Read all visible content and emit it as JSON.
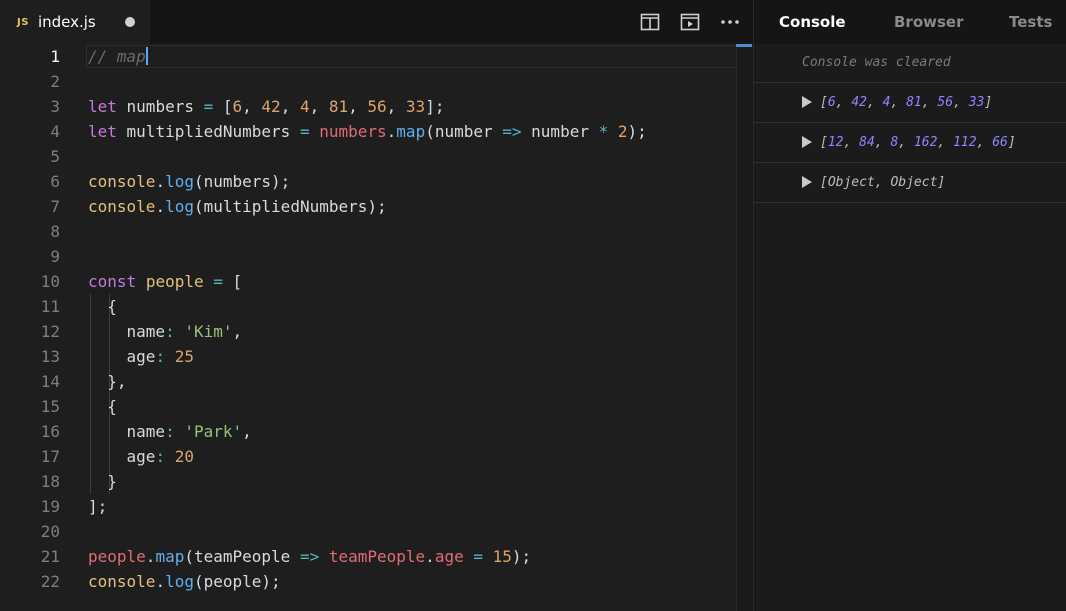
{
  "editor": {
    "tab": {
      "badge": "JS",
      "filename": "index.js"
    },
    "actions": [
      "split-editor-icon",
      "preview-icon",
      "more-icon"
    ],
    "line_numbers": [
      "1",
      "2",
      "3",
      "4",
      "5",
      "6",
      "7",
      "8",
      "9",
      "10",
      "11",
      "12",
      "13",
      "14",
      "15",
      "16",
      "17",
      "18",
      "19",
      "20",
      "21",
      "22"
    ],
    "lines": [
      [
        {
          "t": "// map",
          "c": "comment"
        }
      ],
      [],
      [
        {
          "t": "let",
          "c": "kw"
        },
        {
          "t": " numbers ",
          "c": "ident"
        },
        {
          "t": "=",
          "c": "op"
        },
        {
          "t": " [",
          "c": "punct"
        },
        {
          "t": "6",
          "c": "num"
        },
        {
          "t": ", ",
          "c": "punct"
        },
        {
          "t": "42",
          "c": "num"
        },
        {
          "t": ", ",
          "c": "punct"
        },
        {
          "t": "4",
          "c": "num"
        },
        {
          "t": ", ",
          "c": "punct"
        },
        {
          "t": "81",
          "c": "num"
        },
        {
          "t": ", ",
          "c": "punct"
        },
        {
          "t": "56",
          "c": "num"
        },
        {
          "t": ", ",
          "c": "punct"
        },
        {
          "t": "33",
          "c": "num"
        },
        {
          "t": "];",
          "c": "punct"
        }
      ],
      [
        {
          "t": "let",
          "c": "kw"
        },
        {
          "t": " multipliedNumbers ",
          "c": "ident"
        },
        {
          "t": "=",
          "c": "op"
        },
        {
          "t": " ",
          "c": "punct"
        },
        {
          "t": "numbers",
          "c": "var"
        },
        {
          "t": ".",
          "c": "punct"
        },
        {
          "t": "map",
          "c": "fn"
        },
        {
          "t": "(number ",
          "c": "ident"
        },
        {
          "t": "=>",
          "c": "op"
        },
        {
          "t": " number ",
          "c": "ident"
        },
        {
          "t": "*",
          "c": "op"
        },
        {
          "t": " ",
          "c": "punct"
        },
        {
          "t": "2",
          "c": "num"
        },
        {
          "t": ");",
          "c": "punct"
        }
      ],
      [],
      [
        {
          "t": "console",
          "c": "obj"
        },
        {
          "t": ".",
          "c": "punct"
        },
        {
          "t": "log",
          "c": "fn"
        },
        {
          "t": "(numbers);",
          "c": "ident"
        }
      ],
      [
        {
          "t": "console",
          "c": "obj"
        },
        {
          "t": ".",
          "c": "punct"
        },
        {
          "t": "log",
          "c": "fn"
        },
        {
          "t": "(multipliedNumbers);",
          "c": "ident"
        }
      ],
      [],
      [],
      [
        {
          "t": "const",
          "c": "kw"
        },
        {
          "t": " ",
          "c": "punct"
        },
        {
          "t": "people",
          "c": "obj"
        },
        {
          "t": " ",
          "c": "punct"
        },
        {
          "t": "=",
          "c": "op"
        },
        {
          "t": " [",
          "c": "punct"
        }
      ],
      [
        {
          "t": "  {",
          "c": "punct"
        }
      ],
      [
        {
          "t": "    name",
          "c": "ident"
        },
        {
          "t": ":",
          "c": "op"
        },
        {
          "t": " ",
          "c": "punct"
        },
        {
          "t": "'Kim'",
          "c": "str"
        },
        {
          "t": ",",
          "c": "punct"
        }
      ],
      [
        {
          "t": "    age",
          "c": "ident"
        },
        {
          "t": ":",
          "c": "op"
        },
        {
          "t": " ",
          "c": "punct"
        },
        {
          "t": "25",
          "c": "num"
        }
      ],
      [
        {
          "t": "  },",
          "c": "punct"
        }
      ],
      [
        {
          "t": "  {",
          "c": "punct"
        }
      ],
      [
        {
          "t": "    name",
          "c": "ident"
        },
        {
          "t": ":",
          "c": "op"
        },
        {
          "t": " ",
          "c": "punct"
        },
        {
          "t": "'Park'",
          "c": "str"
        },
        {
          "t": ",",
          "c": "punct"
        }
      ],
      [
        {
          "t": "    age",
          "c": "ident"
        },
        {
          "t": ":",
          "c": "op"
        },
        {
          "t": " ",
          "c": "punct"
        },
        {
          "t": "20",
          "c": "num"
        }
      ],
      [
        {
          "t": "  }",
          "c": "punct"
        }
      ],
      [
        {
          "t": "];",
          "c": "punct"
        }
      ],
      [],
      [
        {
          "t": "people",
          "c": "var"
        },
        {
          "t": ".",
          "c": "punct"
        },
        {
          "t": "map",
          "c": "fn"
        },
        {
          "t": "(teamPeople ",
          "c": "ident"
        },
        {
          "t": "=>",
          "c": "op"
        },
        {
          "t": " ",
          "c": "punct"
        },
        {
          "t": "teamPeople",
          "c": "var"
        },
        {
          "t": ".",
          "c": "punct"
        },
        {
          "t": "age",
          "c": "var"
        },
        {
          "t": " ",
          "c": "punct"
        },
        {
          "t": "=",
          "c": "op"
        },
        {
          "t": " ",
          "c": "punct"
        },
        {
          "t": "15",
          "c": "num"
        },
        {
          "t": ");",
          "c": "punct"
        }
      ],
      [
        {
          "t": "console",
          "c": "obj"
        },
        {
          "t": ".",
          "c": "punct"
        },
        {
          "t": "log",
          "c": "fn"
        },
        {
          "t": "(people);",
          "c": "ident"
        }
      ]
    ]
  },
  "side": {
    "tabs": [
      "Console",
      "Browser",
      "Tests"
    ],
    "active_tab": "Console",
    "console": {
      "cleared": "Console was cleared",
      "entries": [
        [
          {
            "t": "[",
            "c": "p"
          },
          {
            "t": "6",
            "c": "n"
          },
          {
            "t": ", ",
            "c": "p"
          },
          {
            "t": "42",
            "c": "n"
          },
          {
            "t": ", ",
            "c": "p"
          },
          {
            "t": "4",
            "c": "n"
          },
          {
            "t": ", ",
            "c": "p"
          },
          {
            "t": "81",
            "c": "n"
          },
          {
            "t": ", ",
            "c": "p"
          },
          {
            "t": "56",
            "c": "n"
          },
          {
            "t": ", ",
            "c": "p"
          },
          {
            "t": "33",
            "c": "n"
          },
          {
            "t": "]",
            "c": "p"
          }
        ],
        [
          {
            "t": "[",
            "c": "p"
          },
          {
            "t": "12",
            "c": "n"
          },
          {
            "t": ", ",
            "c": "p"
          },
          {
            "t": "84",
            "c": "n"
          },
          {
            "t": ", ",
            "c": "p"
          },
          {
            "t": "8",
            "c": "n"
          },
          {
            "t": ", ",
            "c": "p"
          },
          {
            "t": "162",
            "c": "n"
          },
          {
            "t": ", ",
            "c": "p"
          },
          {
            "t": "112",
            "c": "n"
          },
          {
            "t": ", ",
            "c": "p"
          },
          {
            "t": "66",
            "c": "n"
          },
          {
            "t": "]",
            "c": "p"
          }
        ],
        [
          {
            "t": "[Object, Object]",
            "c": "p"
          }
        ]
      ]
    }
  }
}
